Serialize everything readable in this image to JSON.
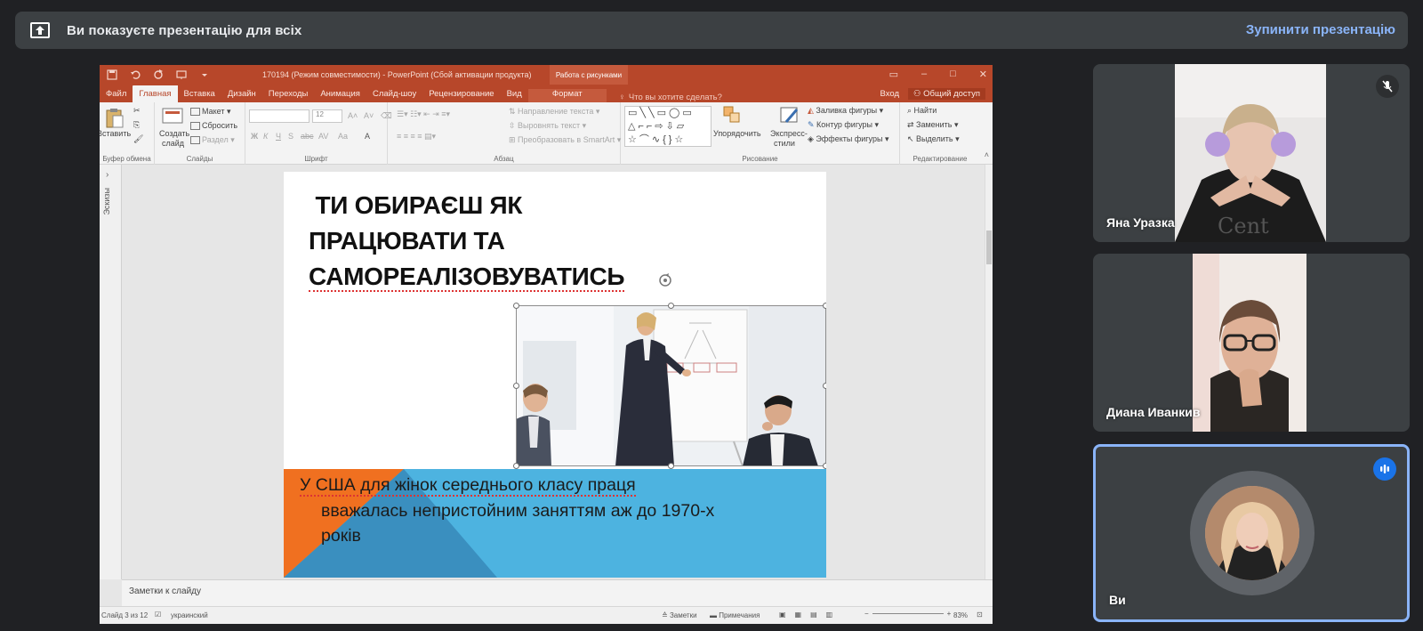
{
  "banner": {
    "icon": "present-to-all-icon",
    "message": "Ви показуєте презентацію для всіх",
    "stop_label": "Зупинити презентацію"
  },
  "powerpoint": {
    "window_title": "170194 (Режим совместимости) - PowerPoint (Сбой активации продукта)",
    "context_tab": "Работа с рисунками",
    "tabs": [
      "Файл",
      "Главная",
      "Вставка",
      "Дизайн",
      "Переходы",
      "Анимация",
      "Слайд-шоу",
      "Рецензирование",
      "Вид",
      "Формат"
    ],
    "active_tab": "Главная",
    "tell_me": "Что вы хотите сделать?",
    "sign_in": "Вход",
    "share": "Общий доступ",
    "ribbon": {
      "clipboard": {
        "paste": "Вставить",
        "label": "Буфер обмена"
      },
      "slides": {
        "new_slide_line1": "Создать",
        "new_slide_line2": "слайд",
        "layout": "Макет",
        "reset": "Сбросить",
        "section": "Раздел",
        "label": "Слайды"
      },
      "font": {
        "size": "12",
        "label": "Шрифт",
        "bold": "Ж",
        "italic": "К",
        "underline": "Ч",
        "shadow": "S",
        "strike": "abc",
        "spacing": "AV",
        "case": "Aa",
        "color": "A"
      },
      "paragraph": {
        "text_direction": "Направление текста",
        "align_text": "Выровнять текст",
        "smartart": "Преобразовать в SmartArt",
        "label": "Абзац"
      },
      "drawing": {
        "arrange": "Упорядочить",
        "quick_styles_line1": "Экспресс-",
        "quick_styles_line2": "стили",
        "fill": "Заливка фигуры",
        "outline": "Контур фигуры",
        "effects": "Эффекты фигуры",
        "label": "Рисование"
      },
      "editing": {
        "find": "Найти",
        "replace": "Заменить",
        "select": "Выделить",
        "label": "Редактирование"
      }
    },
    "thumbnails_label": "Эскизы",
    "slide": {
      "headline_lines": [
        " ТИ ОБИРАЄШ ЯК",
        "ПРАЦЮВАТИ ТА",
        "САМОРЕАЛІЗОВУВАТИСЬ"
      ],
      "body_lines": [
        "У США для жінок середнього класу праця",
        "вважалась непристойним заняттям аж до 1970-х",
        "років"
      ],
      "colors": {
        "orange": "#f07020",
        "blue": "#4db3e0",
        "dark_blue": "#3a8fbf"
      }
    },
    "notes_placeholder": "Заметки к слайду",
    "status": {
      "slide_counter": "Слайд 3 из 12",
      "language": "украинский",
      "notes_btn": "Заметки",
      "comments_btn": "Примечания",
      "zoom": "83%"
    }
  },
  "participants": [
    {
      "name": "Яна Уразка",
      "muted": true
    },
    {
      "name": "Диана Иванкив",
      "muted": false
    },
    {
      "name": "Ви",
      "speaking": true
    }
  ]
}
